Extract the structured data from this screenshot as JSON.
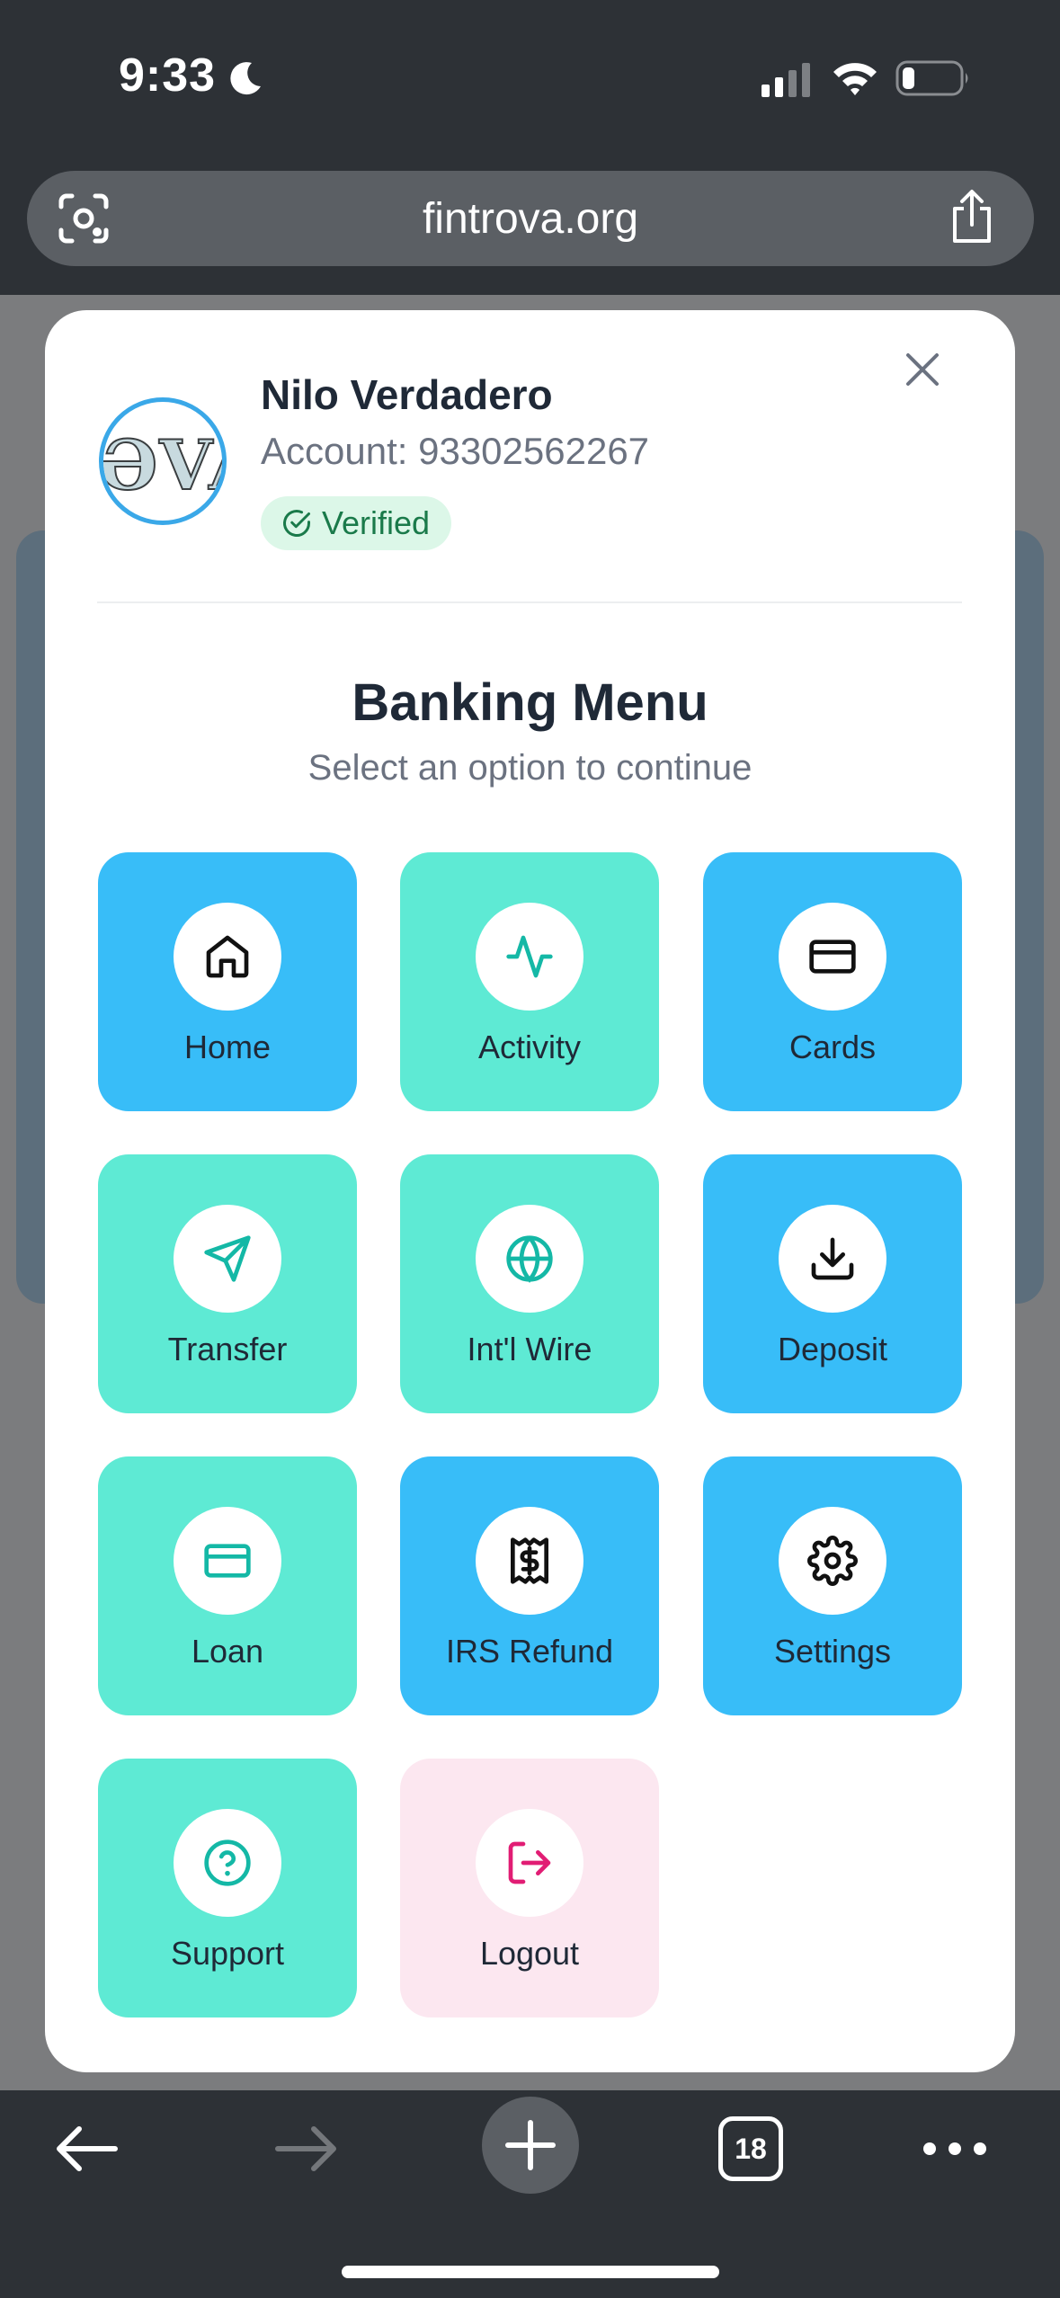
{
  "status_bar": {
    "time": "9:33"
  },
  "browser": {
    "url": "fintrova.org",
    "tab_count": "18"
  },
  "profile": {
    "name": "Nilo Verdadero",
    "account": "Account: 93302562267",
    "verified": "Verified",
    "avatar_text": "ƏVA"
  },
  "menu": {
    "title": "Banking Menu",
    "subtitle": "Select an option to continue",
    "items": [
      {
        "label": "Home",
        "icon": "home-icon",
        "color": "#38bdf8"
      },
      {
        "label": "Activity",
        "icon": "activity-icon",
        "color": "#5eead4"
      },
      {
        "label": "Cards",
        "icon": "card-icon",
        "color": "#38bdf8"
      },
      {
        "label": "Transfer",
        "icon": "send-icon",
        "color": "#5eead4"
      },
      {
        "label": "Int'l Wire",
        "icon": "globe-icon",
        "color": "#5eead4"
      },
      {
        "label": "Deposit",
        "icon": "download-icon",
        "color": "#38bdf8"
      },
      {
        "label": "Loan",
        "icon": "card-icon",
        "color": "#5eead4"
      },
      {
        "label": "IRS Refund",
        "icon": "receipt-icon",
        "color": "#38bdf8"
      },
      {
        "label": "Settings",
        "icon": "gear-icon",
        "color": "#38bdf8"
      },
      {
        "label": "Support",
        "icon": "help-circle-icon",
        "color": "#5eead4"
      },
      {
        "label": "Logout",
        "icon": "logout-icon",
        "color": "#fce7f0"
      }
    ]
  },
  "colors": {
    "accent_blue": "#38bdf8",
    "accent_teal": "#5eead4",
    "logout_pink": "#fce7f0",
    "icon_teal": "#14b8a6",
    "logout_red": "#e11d74"
  }
}
